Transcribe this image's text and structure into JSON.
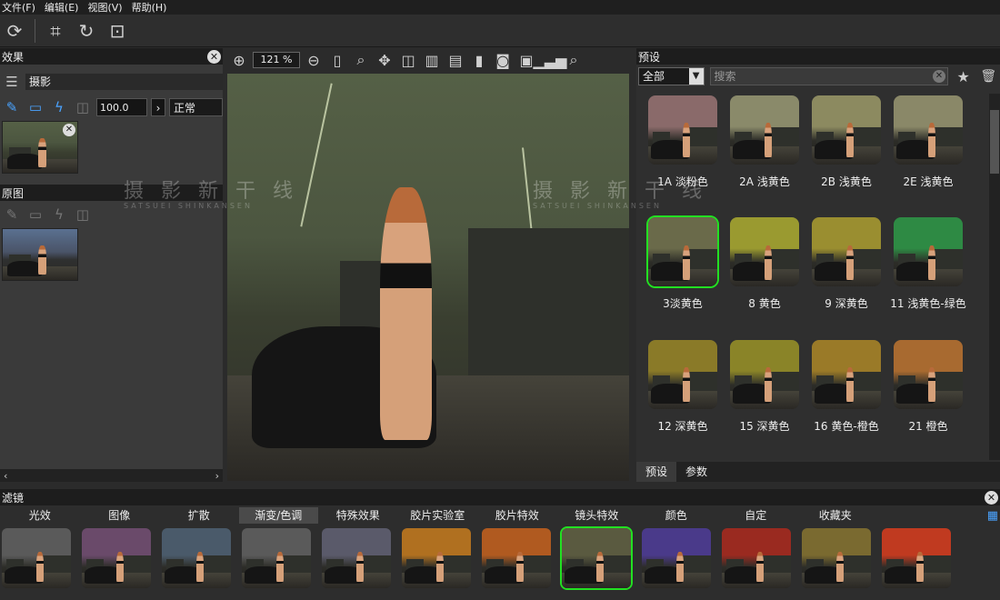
{
  "menu": [
    "文件(F)",
    "编辑(E)",
    "视图(V)",
    "帮助(H)"
  ],
  "effects_panel": {
    "title": "效果",
    "layer_name": "摄影",
    "opacity": "100.0",
    "blend_mode": "正常"
  },
  "original_panel": {
    "title": "原图"
  },
  "preview": {
    "zoom": "121 %"
  },
  "presets_panel": {
    "title": "预设",
    "category": "全部",
    "search_placeholder": "搜索",
    "items": [
      {
        "label": "1A 淡粉色",
        "tint": "#8a6a6a",
        "selected": false
      },
      {
        "label": "2A 浅黄色",
        "tint": "#8a8a6a",
        "selected": false
      },
      {
        "label": "2B 浅黄色",
        "tint": "#8c8a60",
        "selected": false
      },
      {
        "label": "2E 浅黄色",
        "tint": "#8a8868",
        "selected": false
      },
      {
        "label": "3淡黄色",
        "tint": "#6a6a4a",
        "selected": true
      },
      {
        "label": "8 黄色",
        "tint": "#9a9a30",
        "selected": false
      },
      {
        "label": "9 深黄色",
        "tint": "#9a8e30",
        "selected": false
      },
      {
        "label": "11 浅黄色-绿色",
        "tint": "#2e8a44",
        "selected": false
      },
      {
        "label": "12 深黄色",
        "tint": "#8a7a28",
        "selected": false
      },
      {
        "label": "15 深黄色",
        "tint": "#8a8428",
        "selected": false
      },
      {
        "label": "16 黄色-橙色",
        "tint": "#9a7a28",
        "selected": false
      },
      {
        "label": "21 橙色",
        "tint": "#a86a30",
        "selected": false
      }
    ],
    "tabs": [
      "预设",
      "参数"
    ]
  },
  "watermark": {
    "title": "摄 影 新 干 线",
    "subtitle": "SATSUEI SHINKANSEN"
  },
  "filters_panel": {
    "title": "滤镜",
    "categories": [
      "光效",
      "图像",
      "扩散",
      "渐变/色调",
      "特殊效果",
      "胶片实验室",
      "胶片特效",
      "镜头特效",
      "颜色",
      "自定",
      "收藏夹"
    ],
    "active_category": "渐变/色调",
    "thumbnails": [
      {
        "tint": "#5a5a5a",
        "selected": false
      },
      {
        "tint": "#6a4a6a",
        "selected": false
      },
      {
        "tint": "#4a5a6a",
        "selected": false
      },
      {
        "tint": "#5a5a5a",
        "selected": false
      },
      {
        "tint": "#5a5a6a",
        "selected": false
      },
      {
        "tint": "#b07020",
        "selected": false
      },
      {
        "tint": "#b05a20",
        "selected": false
      },
      {
        "tint": "#5a5a40",
        "selected": true
      },
      {
        "tint": "#4a3a8a",
        "selected": false
      },
      {
        "tint": "#9a2a20",
        "selected": false
      },
      {
        "tint": "#7a6a30",
        "selected": false
      },
      {
        "tint": "#c03a20",
        "selected": false
      }
    ]
  }
}
